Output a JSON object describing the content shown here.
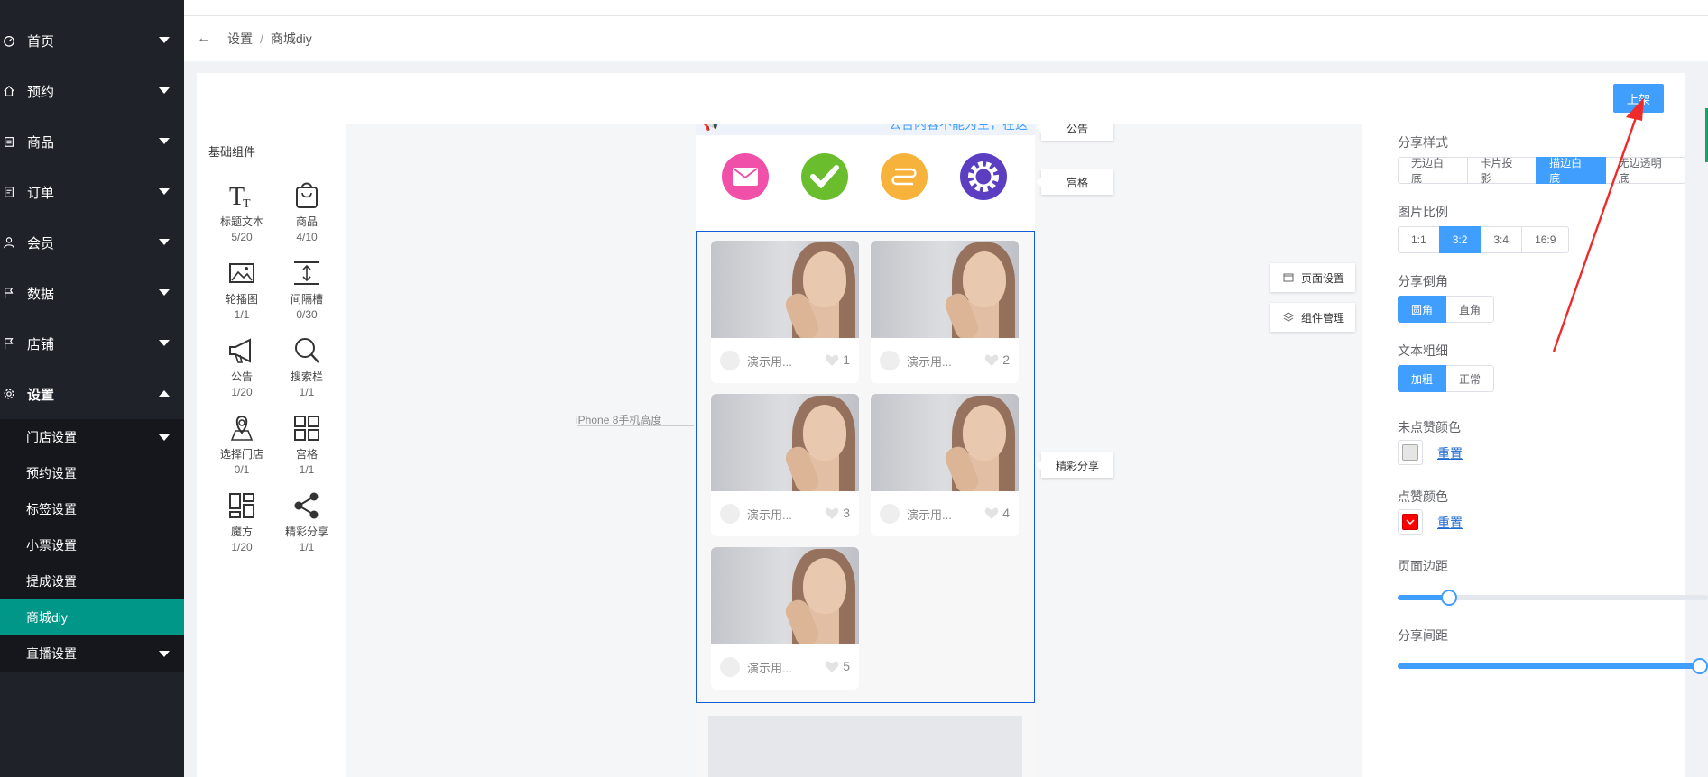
{
  "sidebar": {
    "items": [
      {
        "label": "首页",
        "icon": "dashboard-icon"
      },
      {
        "label": "预约",
        "icon": "home-icon"
      },
      {
        "label": "商品",
        "icon": "product-icon"
      },
      {
        "label": "订单",
        "icon": "order-icon"
      },
      {
        "label": "会员",
        "icon": "user-icon"
      },
      {
        "label": "数据",
        "icon": "flag-icon"
      },
      {
        "label": "店铺",
        "icon": "flag-icon"
      },
      {
        "label": "设置",
        "icon": "gear-icon"
      }
    ],
    "sub_items": [
      {
        "label": "门店设置"
      },
      {
        "label": "预约设置"
      },
      {
        "label": "标签设置"
      },
      {
        "label": "小票设置"
      },
      {
        "label": "提成设置"
      },
      {
        "label": "商城diy"
      },
      {
        "label": "直播设置"
      }
    ]
  },
  "breadcrumb": {
    "back": "←",
    "level1": "设置",
    "sep": "/",
    "level2": "商城diy"
  },
  "header": {
    "publish_label": "上架"
  },
  "components": {
    "title": "基础组件",
    "items": [
      {
        "label": "标题文本",
        "count": "5/20",
        "icon": "title-text-icon"
      },
      {
        "label": "商品",
        "count": "4/10",
        "icon": "product-bag-icon"
      },
      {
        "label": "轮播图",
        "count": "1/1",
        "icon": "carousel-icon"
      },
      {
        "label": "间隔槽",
        "count": "0/30",
        "icon": "spacer-icon"
      },
      {
        "label": "公告",
        "count": "1/20",
        "icon": "megaphone-icon"
      },
      {
        "label": "搜索栏",
        "count": "1/1",
        "icon": "search-icon"
      },
      {
        "label": "选择门店",
        "count": "0/1",
        "icon": "store-location-icon"
      },
      {
        "label": "宫格",
        "count": "1/1",
        "icon": "grid-icon"
      },
      {
        "label": "魔方",
        "count": "1/20",
        "icon": "magic-cube-icon"
      },
      {
        "label": "精彩分享",
        "count": "1/1",
        "icon": "share-icon"
      }
    ]
  },
  "canvas": {
    "height_label": "iPhone 8手机高度",
    "notice_text": "公告内容不能为空，在这",
    "grid_icons": [
      {
        "icon": "mail-icon",
        "color": "#f050a8"
      },
      {
        "icon": "check-icon",
        "color": "#6abe2e"
      },
      {
        "icon": "route-icon",
        "color": "#f7b23b"
      },
      {
        "icon": "gear-icon",
        "color": "#5b3ec2"
      }
    ],
    "share_cards": [
      {
        "title": "演示用...",
        "likes": "1"
      },
      {
        "title": "演示用...",
        "likes": "2"
      },
      {
        "title": "演示用...",
        "likes": "3"
      },
      {
        "title": "演示用...",
        "likes": "4"
      },
      {
        "title": "演示用...",
        "likes": "5"
      }
    ],
    "tags": {
      "notice": "公告",
      "grid": "宫格",
      "share": "精彩分享"
    },
    "page_settings": "页面设置",
    "component_manage": "组件管理"
  },
  "settings": {
    "share_style": {
      "label": "分享样式",
      "options": [
        "无边白底",
        "卡片投影",
        "描边白底",
        "无边透明底"
      ],
      "selected": 2
    },
    "image_ratio": {
      "label": "图片比例",
      "options": [
        "1:1",
        "3:2",
        "3:4",
        "16:9"
      ],
      "selected": 1
    },
    "corner": {
      "label": "分享倒角",
      "options": [
        "圆角",
        "直角"
      ],
      "selected": 0
    },
    "text_weight": {
      "label": "文本粗细",
      "options": [
        "加粗",
        "正常"
      ],
      "selected": 0
    },
    "unliked_color": {
      "label": "未点赞颜色",
      "value": "#e5e5e5",
      "reset": "重置"
    },
    "liked_color": {
      "label": "点赞颜色",
      "value": "#ff0000",
      "reset": "重置"
    },
    "page_margin": {
      "label": "页面边距",
      "value": 0.14
    },
    "share_spacing": {
      "label": "分享间距",
      "value": 1.0
    }
  },
  "colors": {
    "accent": "#409eff",
    "sidebar_bg": "#1f2229",
    "active_sub": "#009688",
    "annotation_arrow": "#ee2a2a"
  }
}
